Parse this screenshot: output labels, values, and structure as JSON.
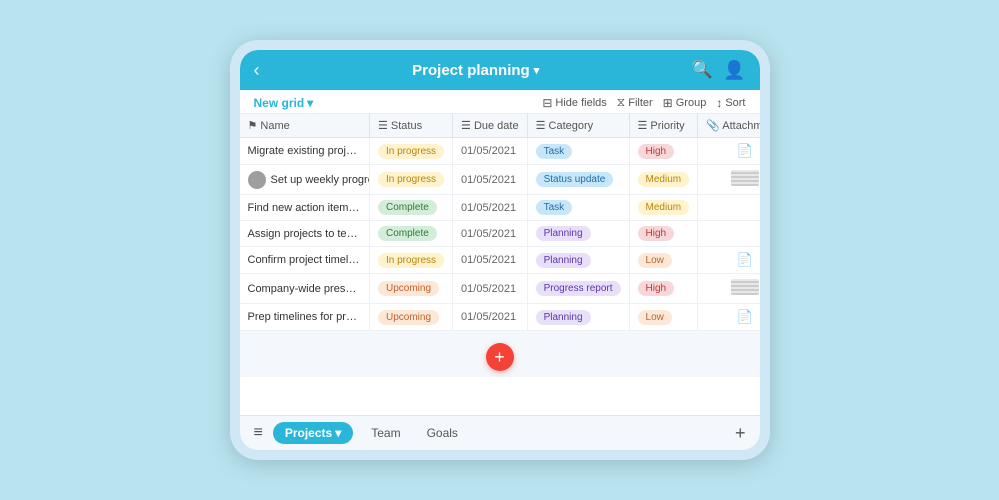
{
  "header": {
    "back_icon": "‹",
    "title": "Project planning",
    "title_chevron": "▾",
    "search_icon": "🔍",
    "user_icon": "👤"
  },
  "toolbar": {
    "new_grid_label": "New grid",
    "new_grid_chevron": "▾",
    "hide_fields_icon": "⊟",
    "hide_fields_label": "Hide fields",
    "filter_icon": "⧖",
    "filter_label": "Filter",
    "group_icon": "⊞",
    "group_label": "Group",
    "sort_icon": "↕",
    "sort_label": "Sort"
  },
  "columns": [
    {
      "icon": "⚑",
      "label": "Name"
    },
    {
      "icon": "☰",
      "label": "Status"
    },
    {
      "icon": "☰",
      "label": "Due date"
    },
    {
      "icon": "☰",
      "label": "Category"
    },
    {
      "icon": "☰",
      "label": "Priority"
    },
    {
      "icon": "📎",
      "label": "Attachments"
    }
  ],
  "rows": [
    {
      "name": "Migrate existing projec...",
      "status": "In progress",
      "status_type": "inprogress",
      "due_date": "01/05/2021",
      "category": "Task",
      "category_type": "task",
      "priority": "High",
      "priority_type": "high",
      "attachment": "icon"
    },
    {
      "name": "Set up weekly progress...",
      "status": "In progress",
      "status_type": "inprogress",
      "due_date": "01/05/2021",
      "category": "Status update",
      "category_type": "statusupdate",
      "priority": "Medium",
      "priority_type": "medium",
      "attachment": "image",
      "has_avatar": true
    },
    {
      "name": "Find new action items...",
      "status": "Complete",
      "status_type": "complete",
      "due_date": "01/05/2021",
      "category": "Task",
      "category_type": "task",
      "priority": "Medium",
      "priority_type": "medium",
      "attachment": "none"
    },
    {
      "name": "Assign projects to tea...",
      "status": "Complete",
      "status_type": "complete",
      "due_date": "01/05/2021",
      "category": "Planning",
      "category_type": "planning",
      "priority": "High",
      "priority_type": "high",
      "attachment": "none"
    },
    {
      "name": "Confirm project timelines",
      "status": "In progress",
      "status_type": "inprogress",
      "due_date": "01/05/2021",
      "category": "Planning",
      "category_type": "planning",
      "priority": "Low",
      "priority_type": "low",
      "attachment": "icon"
    },
    {
      "name": "Company-wide presen...",
      "status": "Upcoming",
      "status_type": "upcoming",
      "due_date": "01/05/2021",
      "category": "Progress report",
      "category_type": "progressreport",
      "priority": "High",
      "priority_type": "high",
      "attachment": "image"
    },
    {
      "name": "Prep timelines for pres...",
      "status": "Upcoming",
      "status_type": "upcoming",
      "due_date": "01/05/2021",
      "category": "Planning",
      "category_type": "planning",
      "priority": "Low",
      "priority_type": "low",
      "attachment": "icon"
    }
  ],
  "add_button_label": "+",
  "bottom_nav": {
    "menu_icon": "≡",
    "tabs": [
      {
        "label": "Projects",
        "active": true,
        "chevron": "▾"
      },
      {
        "label": "Team",
        "active": false
      },
      {
        "label": "Goals",
        "active": false
      }
    ],
    "add_icon": "+"
  }
}
